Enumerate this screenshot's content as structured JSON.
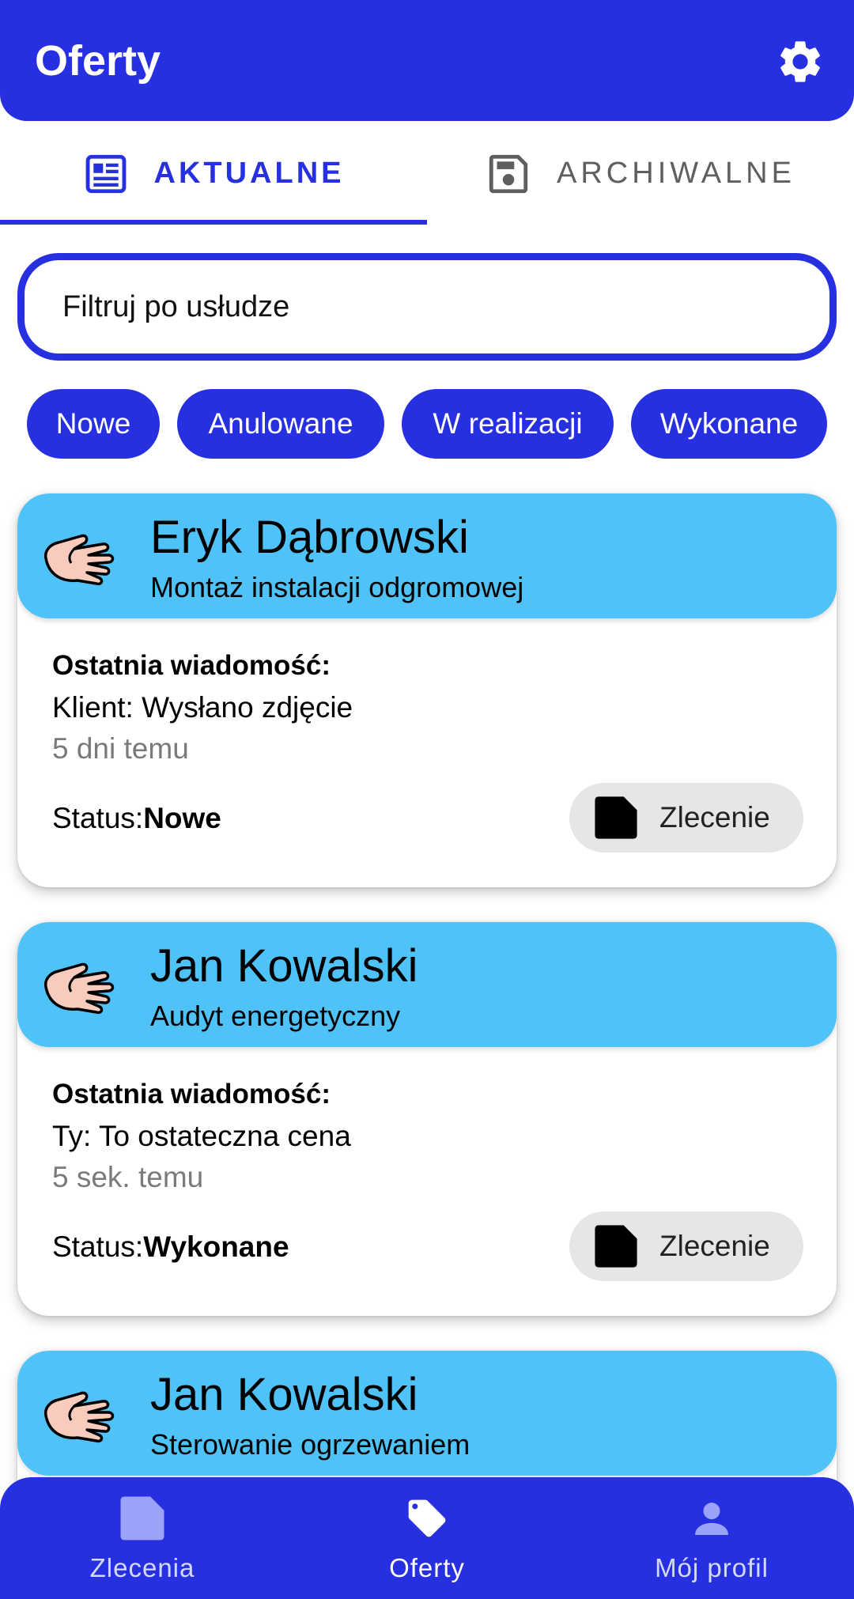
{
  "app_bar": {
    "title": "Oferty",
    "settings_icon": "gear-icon"
  },
  "tabs": [
    {
      "label": "AKTUALNE",
      "icon": "newspaper-icon",
      "active": true
    },
    {
      "label": "ARCHIWALNE",
      "icon": "save-icon",
      "active": false
    }
  ],
  "search": {
    "placeholder": "Filtruj po usłudze"
  },
  "filters": [
    "Nowe",
    "Anulowane",
    "W realizacji",
    "Wykonane"
  ],
  "offers": [
    {
      "name": "Eryk Dąbrowski",
      "service": "Montaż instalacji odgromowej",
      "last_message_label": "Ostatnia wiadomość:",
      "last_message": "Klient: Wysłano zdjęcie",
      "time": "5 dni temu",
      "status_label": "Status:",
      "status": "Nowe",
      "order_button": "Zlecenie"
    },
    {
      "name": "Jan Kowalski",
      "service": "Audyt energetyczny",
      "last_message_label": "Ostatnia wiadomość:",
      "last_message": "Ty: To ostateczna cena",
      "time": "5 sek. temu",
      "status_label": "Status:",
      "status": "Wykonane",
      "order_button": "Zlecenie"
    },
    {
      "name": "Jan Kowalski",
      "service": "Sterowanie ogrzewaniem"
    }
  ],
  "bottom_nav": [
    {
      "label": "Zlecenia",
      "icon": "document-icon",
      "active": false
    },
    {
      "label": "Oferty",
      "icon": "tag-icon",
      "active": true
    },
    {
      "label": "Mój profil",
      "icon": "person-icon",
      "active": false
    }
  ],
  "colors": {
    "primary": "#2730e0",
    "card_header": "#4fc2f7",
    "chip_grey": "#e6e6e6"
  }
}
